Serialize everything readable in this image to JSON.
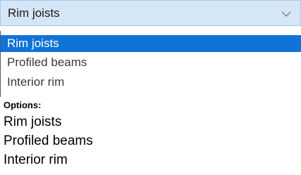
{
  "select": {
    "value": "Rim joists",
    "icon": "chevron-down-icon",
    "background_color": "#d5e6f6"
  },
  "dropdown": {
    "items": [
      {
        "label": "Rim joists",
        "selected": true
      },
      {
        "label": "Profiled beams",
        "selected": false
      },
      {
        "label": "Interior rim",
        "selected": false
      }
    ],
    "selected_color": "#1073d6"
  },
  "options": {
    "heading": "Options:",
    "items": [
      "Rim joists",
      "Profiled beams",
      "Interior rim"
    ]
  }
}
